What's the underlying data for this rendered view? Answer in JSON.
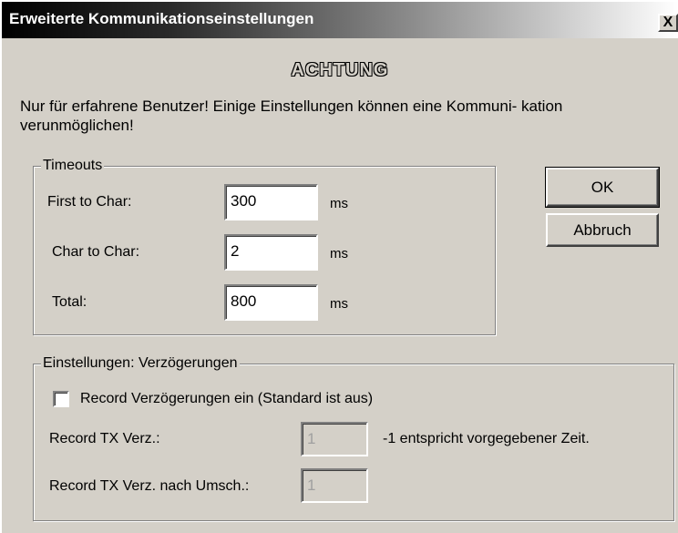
{
  "window": {
    "title": "Erweiterte Kommunikationseinstellungen",
    "close_glyph": "X"
  },
  "heading": "ACHTUNG",
  "warning_text": "Nur für erfahrene Benutzer! Einige Einstellungen können eine Kommuni- kation verunmöglichen!",
  "timeouts": {
    "legend": "Timeouts",
    "rows": [
      {
        "label": "First to Char:",
        "value": "300",
        "unit": "ms"
      },
      {
        "label": "Char to Char:",
        "value": "2",
        "unit": "ms"
      },
      {
        "label": "Total:",
        "value": "800",
        "unit": "ms"
      }
    ]
  },
  "buttons": {
    "ok": "OK",
    "cancel": "Abbruch"
  },
  "delays": {
    "legend": "Einstellungen: Verzögerungen",
    "checkbox_label": "Record Verzögerungen ein (Standard ist aus)",
    "checkbox_checked": false,
    "tx_delay_label": "Record TX Verz.:",
    "tx_delay_value": "1",
    "hint": "-1 entspricht vorgegebener Zeit.",
    "tx_delay_after_label": "Record TX Verz. nach Umsch.:",
    "tx_delay_after_value": "1"
  }
}
